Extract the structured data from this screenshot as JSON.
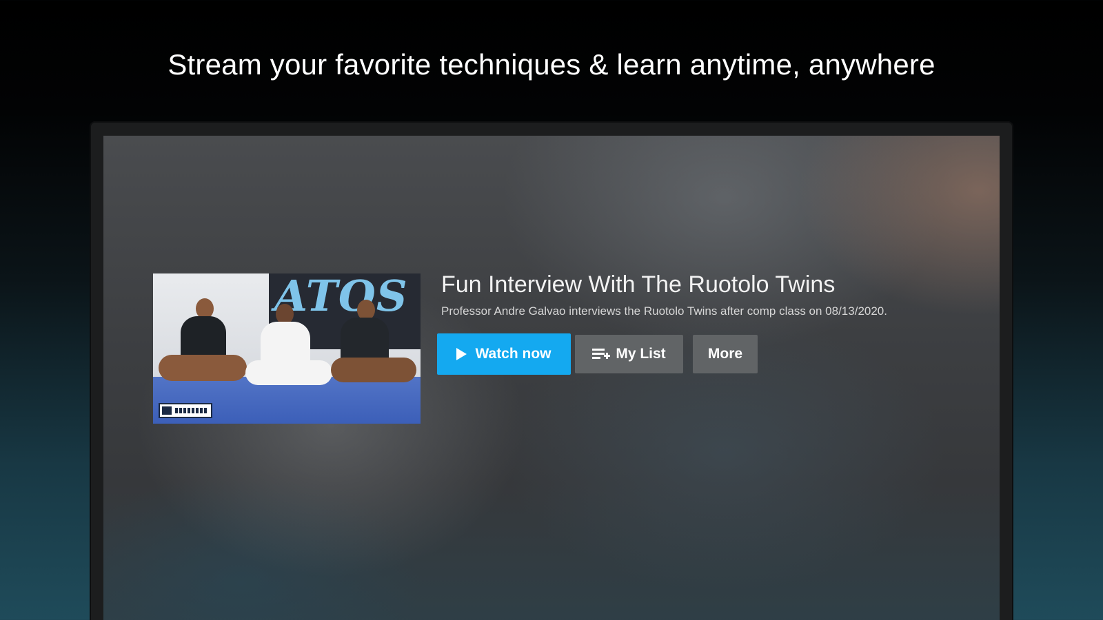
{
  "headline": "Stream your favorite techniques & learn anytime, anywhere",
  "featured": {
    "thumbnail": {
      "banner_text": "ATOS"
    },
    "title": "Fun Interview With The Ruotolo Twins",
    "description": "Professor Andre Galvao interviews the Ruotolo Twins after comp class on 08/13/2020.",
    "actions": {
      "watch_label": "Watch now",
      "mylist_label": "My List",
      "more_label": "More"
    }
  },
  "colors": {
    "accent": "#14a9f0",
    "secondary_button": "#616466"
  },
  "icons": {
    "watch": "play-icon",
    "mylist": "playlist-add-icon"
  }
}
